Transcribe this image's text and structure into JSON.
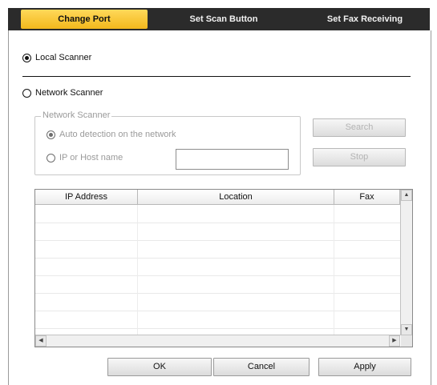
{
  "tabs": [
    {
      "label": "Change Port",
      "active": true
    },
    {
      "label": "Set Scan Button",
      "active": false
    },
    {
      "label": "Set Fax Receiving",
      "active": false
    }
  ],
  "local_scanner": {
    "label": "Local Scanner",
    "selected": true
  },
  "network_scanner": {
    "label": "Network Scanner",
    "selected": false
  },
  "group": {
    "title": "Network Scanner",
    "auto_detect_label": "Auto detection on the network",
    "ip_host_label": "IP or Host name",
    "ip_host_value": ""
  },
  "buttons": {
    "search": "Search",
    "stop": "Stop",
    "ok": "OK",
    "cancel": "Cancel",
    "apply": "Apply"
  },
  "table": {
    "columns": [
      "IP Address",
      "Location",
      "Fax"
    ],
    "rows": []
  },
  "colors": {
    "active_tab": "#f3b81c",
    "tab_strip": "#2b2b2b"
  }
}
